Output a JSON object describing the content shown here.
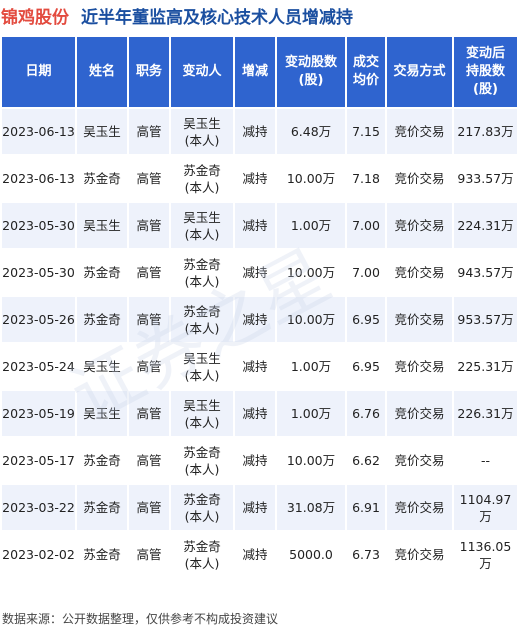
{
  "header": {
    "company": "锦鸡股份",
    "subject": "近半年董监高及核心技术人员增减持"
  },
  "columns": [
    [
      "日期"
    ],
    [
      "姓名"
    ],
    [
      "职务"
    ],
    [
      "变动人"
    ],
    [
      "增减"
    ],
    [
      "变动股数",
      "(股)"
    ],
    [
      "成交",
      "均价"
    ],
    [
      "交易方式"
    ],
    [
      "变动后",
      "持股数",
      "(股)"
    ]
  ],
  "rows": [
    {
      "date": "2023-06-13",
      "name": "吴玉生",
      "role": "高管",
      "changer": [
        "吴玉生",
        "(本人)"
      ],
      "change": "减持",
      "shares": "6.48万",
      "price": "7.15",
      "method": "竞价交易",
      "holding": "217.83万"
    },
    {
      "date": "2023-06-13",
      "name": "苏金奇",
      "role": "高管",
      "changer": [
        "苏金奇",
        "(本人)"
      ],
      "change": "减持",
      "shares": "10.00万",
      "price": "7.18",
      "method": "竞价交易",
      "holding": "933.57万"
    },
    {
      "date": "2023-05-30",
      "name": "吴玉生",
      "role": "高管",
      "changer": [
        "吴玉生",
        "(本人)"
      ],
      "change": "减持",
      "shares": "1.00万",
      "price": "7.00",
      "method": "竞价交易",
      "holding": "224.31万"
    },
    {
      "date": "2023-05-30",
      "name": "苏金奇",
      "role": "高管",
      "changer": [
        "苏金奇",
        "(本人)"
      ],
      "change": "减持",
      "shares": "10.00万",
      "price": "7.00",
      "method": "竞价交易",
      "holding": "943.57万"
    },
    {
      "date": "2023-05-26",
      "name": "苏金奇",
      "role": "高管",
      "changer": [
        "苏金奇",
        "(本人)"
      ],
      "change": "减持",
      "shares": "10.00万",
      "price": "6.95",
      "method": "竞价交易",
      "holding": "953.57万"
    },
    {
      "date": "2023-05-24",
      "name": "吴玉生",
      "role": "高管",
      "changer": [
        "吴玉生",
        "(本人)"
      ],
      "change": "减持",
      "shares": "1.00万",
      "price": "6.95",
      "method": "竞价交易",
      "holding": "225.31万"
    },
    {
      "date": "2023-05-19",
      "name": "吴玉生",
      "role": "高管",
      "changer": [
        "吴玉生",
        "(本人)"
      ],
      "change": "减持",
      "shares": "1.00万",
      "price": "6.76",
      "method": "竞价交易",
      "holding": "226.31万"
    },
    {
      "date": "2023-05-17",
      "name": "苏金奇",
      "role": "高管",
      "changer": [
        "苏金奇",
        "(本人)"
      ],
      "change": "减持",
      "shares": "10.00万",
      "price": "6.62",
      "method": "竞价交易",
      "holding": "--"
    },
    {
      "date": "2023-03-22",
      "name": "苏金奇",
      "role": "高管",
      "changer": [
        "苏金奇",
        "(本人)"
      ],
      "change": "减持",
      "shares": "31.08万",
      "price": "6.91",
      "method": "竞价交易",
      "holding": "1104.97万"
    },
    {
      "date": "2023-02-02",
      "name": "苏金奇",
      "role": "高管",
      "changer": [
        "苏金奇",
        "(本人)"
      ],
      "change": "减持",
      "shares": "5000.0",
      "price": "6.73",
      "method": "竞价交易",
      "holding": "1136.05万"
    }
  ],
  "footer": {
    "source": "数据来源：公开数据整理，仅供参考不构成投资建议"
  },
  "watermark": {
    "text": "证券之星"
  },
  "colors": {
    "company": "#e34b3f",
    "subject": "#1b4fa0",
    "header_bg": "#2f64cf",
    "row_alt_bg": "#eef2fb",
    "reduce_text": "#1a9a3c"
  }
}
